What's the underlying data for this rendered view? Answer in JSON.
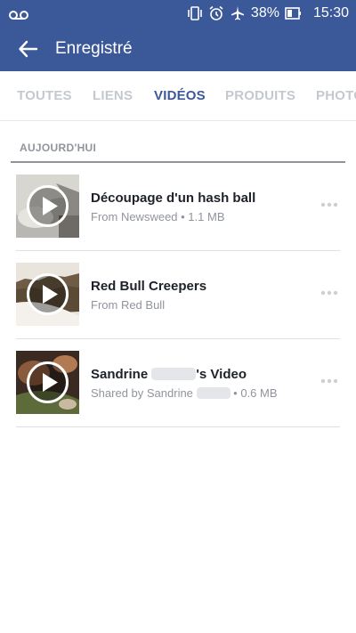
{
  "status_bar": {
    "icons": [
      "voicemail-icon",
      "vibrate-icon",
      "alarm-icon",
      "airplane-icon",
      "battery-icon"
    ],
    "battery_percent": "38%",
    "time": "15:30"
  },
  "app_bar": {
    "back_icon": "arrow-left-icon",
    "title": "Enregistré"
  },
  "tabs": [
    {
      "label": "TOUTES",
      "active": false
    },
    {
      "label": "LIENS",
      "active": false
    },
    {
      "label": "VIDÉOS",
      "active": true
    },
    {
      "label": "PRODUITS",
      "active": false
    },
    {
      "label": "PHOTOS",
      "active": false
    }
  ],
  "section": {
    "label": "AUJOURD'HUI"
  },
  "items": [
    {
      "title": "Découpage d'un hash ball",
      "subtitle": "From Newsweed • 1.1 MB",
      "thumb_icon": "play-icon"
    },
    {
      "title": "Red Bull Creepers",
      "subtitle": "From Red Bull",
      "thumb_icon": "play-icon"
    },
    {
      "title_prefix": "Sandrine",
      "title_suffix": "'s Video",
      "subtitle_prefix": "Shared by Sandrine",
      "subtitle_suffix": "• 0.6 MB",
      "thumb_icon": "play-icon"
    }
  ],
  "colors": {
    "brand": "#3b5998",
    "tab_inactive": "#c4c8cf",
    "text_primary": "#1d2129",
    "text_secondary": "#90949c"
  }
}
